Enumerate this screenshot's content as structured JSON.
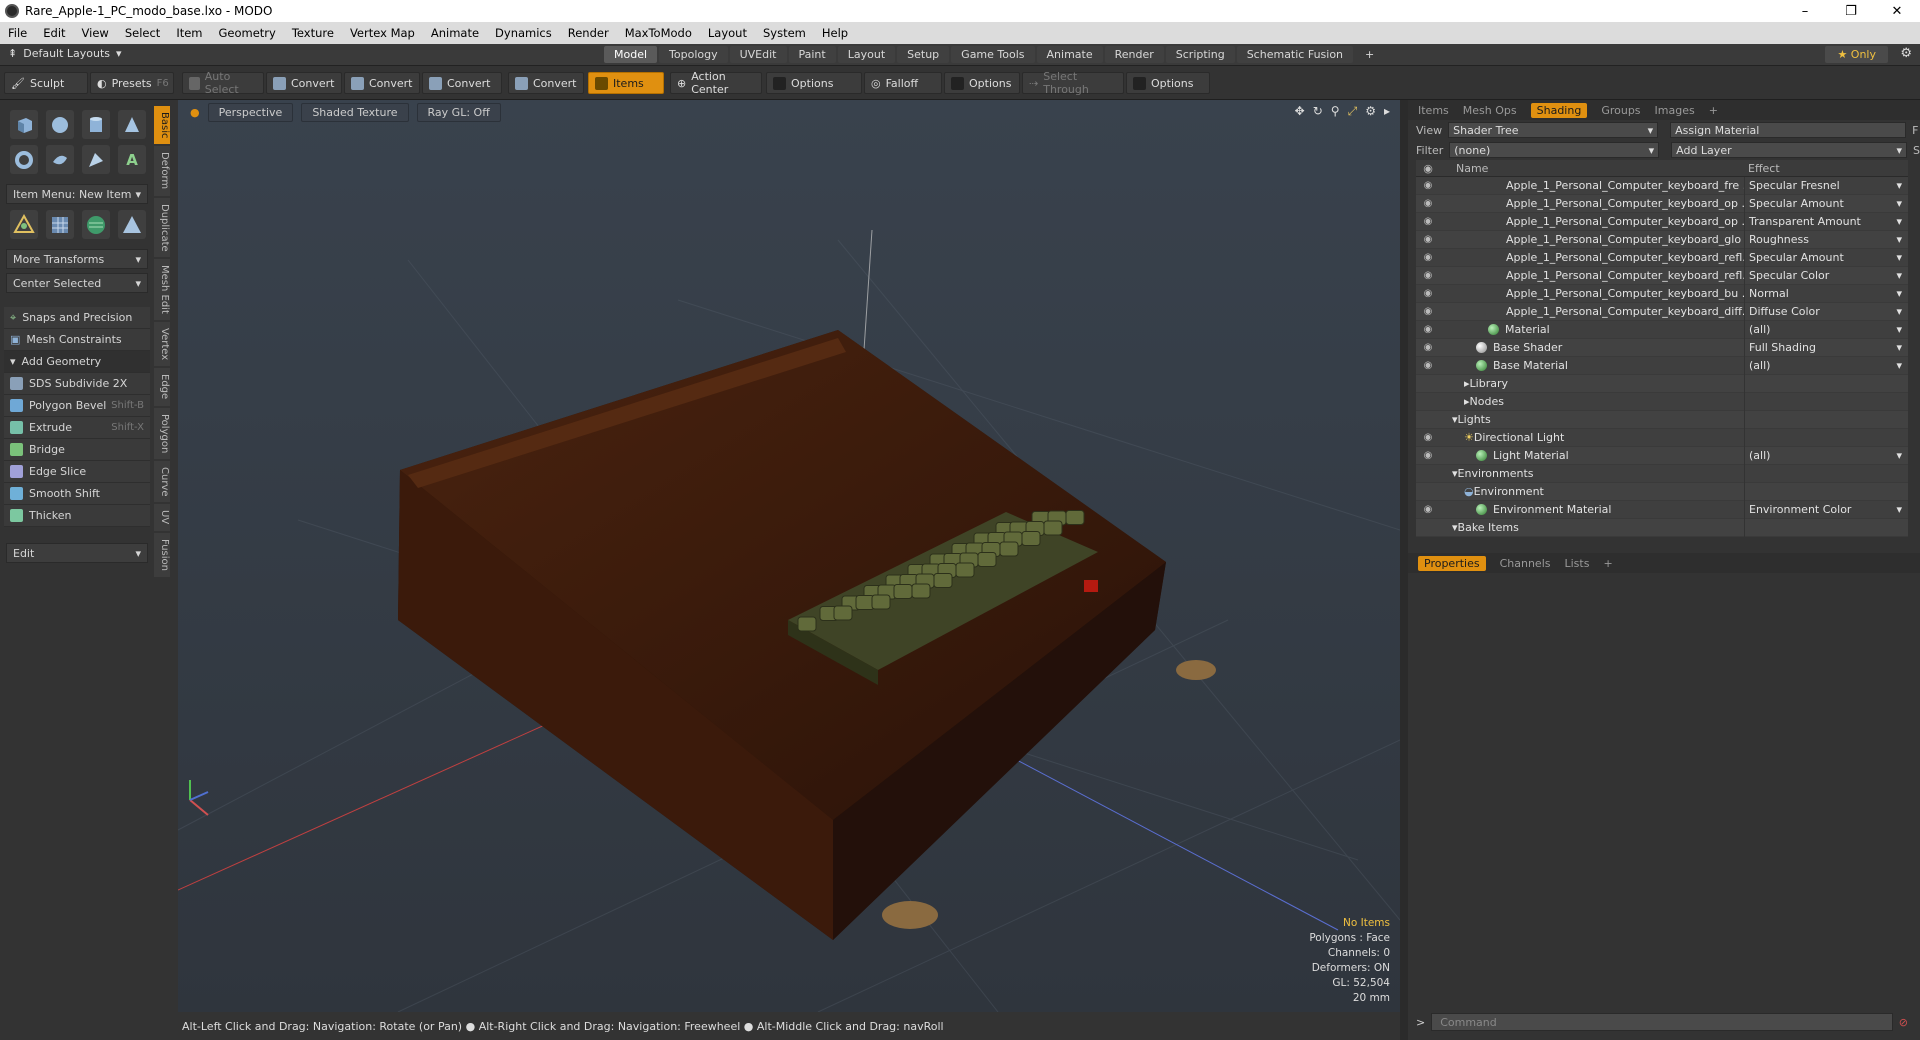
{
  "window": {
    "title": "Rare_Apple-1_PC_modo_base.lxo - MODO",
    "minimize": "–",
    "maximize": "❐",
    "close": "✕"
  },
  "menu": [
    "File",
    "Edit",
    "View",
    "Select",
    "Item",
    "Geometry",
    "Texture",
    "Vertex Map",
    "Animate",
    "Dynamics",
    "Render",
    "MaxToModo",
    "Layout",
    "System",
    "Help"
  ],
  "layouts": {
    "label": "Default Layouts"
  },
  "tabs": [
    "Model",
    "Topology",
    "UVEdit",
    "Paint",
    "Layout",
    "Setup",
    "Game Tools",
    "Animate",
    "Render",
    "Scripting",
    "Schematic Fusion"
  ],
  "tabs_plus": "+",
  "only": "★ Only",
  "toolbar": {
    "sculpt": "Sculpt",
    "presets": "Presets",
    "presets_key": "F6",
    "auto_select": "Auto Select",
    "convert1": "Convert",
    "convert2": "Convert",
    "convert3": "Convert",
    "convert4": "Convert",
    "items": "Items",
    "action_center": "Action Center",
    "options1": "Options",
    "falloff": "Falloff",
    "options2": "Options",
    "select_through": "Select Through",
    "options3": "Options"
  },
  "left": {
    "item_menu": "Item Menu: New Item",
    "more_transforms": "More Transforms",
    "center_selected": "Center Selected",
    "snaps": "Snaps and Precision",
    "mesh_constraints": "Mesh Constraints",
    "add_geometry": "Add Geometry",
    "tools": [
      {
        "label": "SDS Subdivide 2X",
        "key": ""
      },
      {
        "label": "Polygon Bevel",
        "key": "Shift-B"
      },
      {
        "label": "Extrude",
        "key": "Shift-X"
      },
      {
        "label": "Bridge",
        "key": ""
      },
      {
        "label": "Edge Slice",
        "key": ""
      },
      {
        "label": "Smooth Shift",
        "key": ""
      },
      {
        "label": "Thicken",
        "key": ""
      }
    ],
    "edit": "Edit",
    "vtabs": [
      "Basic",
      "Deform",
      "Duplicate",
      "Mesh Edit",
      "Vertex",
      "Edge",
      "Polygon",
      "Curve",
      "UV",
      "Fusion"
    ]
  },
  "viewport": {
    "perspective": "Perspective",
    "shaded": "Shaded Texture",
    "raygl": "Ray GL: Off",
    "info": [
      "No Items",
      "Polygons : Face",
      "Channels: 0",
      "Deformers: ON",
      "GL: 52,504",
      "20 mm"
    ],
    "colors": {
      "wood": "#3a1a0c",
      "keys": "#5a5e34"
    }
  },
  "status": "Alt-Left Click and Drag: Navigation: Rotate (or Pan) ● Alt-Right Click and Drag: Navigation: Freewheel ● Alt-Middle Click and Drag: navRoll",
  "right": {
    "tabs": [
      "Items",
      "Mesh Ops",
      "Shading",
      "Groups",
      "Images"
    ],
    "tabs_plus": "+",
    "view_label": "View",
    "view_value": "Shader Tree",
    "assign": "Assign Material",
    "f": "F",
    "filter_label": "Filter",
    "filter_value": "(none)",
    "add_layer": "Add Layer",
    "s": "S",
    "col_name": "Name",
    "col_effect": "Effect",
    "rows": [
      {
        "name": "Apple_1_Personal_Computer_keyboard_fre ...",
        "effect": "Specular Fresnel",
        "indent": 4,
        "icon": "ball"
      },
      {
        "name": "Apple_1_Personal_Computer_keyboard_op ...",
        "effect": "Specular Amount",
        "indent": 4,
        "icon": "ball"
      },
      {
        "name": "Apple_1_Personal_Computer_keyboard_op ...",
        "effect": "Transparent Amount",
        "indent": 4,
        "icon": "ball"
      },
      {
        "name": "Apple_1_Personal_Computer_keyboard_glo ...",
        "effect": "Roughness",
        "indent": 4,
        "icon": "ball"
      },
      {
        "name": "Apple_1_Personal_Computer_keyboard_refl...",
        "effect": "Specular Amount",
        "indent": 4,
        "icon": "ball"
      },
      {
        "name": "Apple_1_Personal_Computer_keyboard_refl...",
        "effect": "Specular Color",
        "indent": 4,
        "icon": "ball"
      },
      {
        "name": "Apple_1_Personal_Computer_keyboard_bu ...",
        "effect": "Normal",
        "indent": 4,
        "icon": "ball"
      },
      {
        "name": "Apple_1_Personal_Computer_keyboard_diff...",
        "effect": "Diffuse Color",
        "indent": 4,
        "icon": "ball"
      },
      {
        "name": "Material",
        "effect": "(all)",
        "indent": 3,
        "icon": "green"
      },
      {
        "name": "Base Shader",
        "effect": "Full Shading",
        "indent": 2,
        "icon": "gray"
      },
      {
        "name": "Base Material",
        "effect": "(all)",
        "indent": 2,
        "icon": "green"
      },
      {
        "name": "Library",
        "effect": "",
        "indent": 1,
        "icon": "folder"
      },
      {
        "name": "Nodes",
        "effect": "",
        "indent": 1,
        "icon": "folder"
      },
      {
        "name": "Lights",
        "effect": "",
        "indent": 0,
        "icon": "none"
      },
      {
        "name": "Directional Light",
        "effect": "",
        "indent": 1,
        "icon": "light"
      },
      {
        "name": "Light Material",
        "effect": "(all)",
        "indent": 2,
        "icon": "green"
      },
      {
        "name": "Environments",
        "effect": "",
        "indent": 0,
        "icon": "none"
      },
      {
        "name": "Environment",
        "effect": "",
        "indent": 1,
        "icon": "env"
      },
      {
        "name": "Environment Material",
        "effect": "Environment Color",
        "indent": 2,
        "icon": "green"
      },
      {
        "name": "Bake Items",
        "effect": "",
        "indent": 0,
        "icon": "none"
      }
    ],
    "props_tabs": [
      "Properties",
      "Channels",
      "Lists"
    ],
    "props_plus": "+",
    "command_placeholder": "Command"
  }
}
